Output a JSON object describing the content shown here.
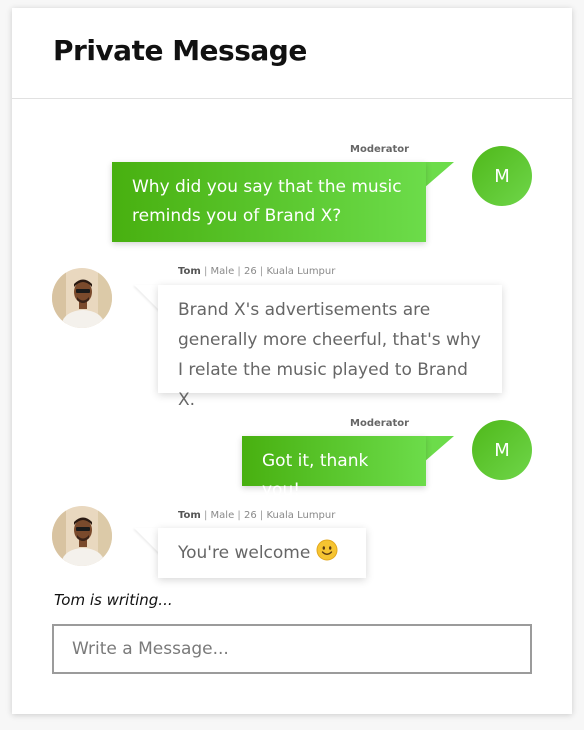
{
  "header": {
    "title": "Private Message"
  },
  "messages": [
    {
      "sender": "Moderator",
      "avatar_initial": "M",
      "lines": [
        "Why did you say that the music",
        "reminds you of Brand X?"
      ]
    },
    {
      "name": "Tom",
      "gender": "Male",
      "age": "26",
      "location": "Kuala Lumpur",
      "sep": "|",
      "lines": [
        "Brand X's advertisements are",
        "generally more cheerful, that's why",
        "I relate the music played to Brand X."
      ]
    },
    {
      "sender": "Moderator",
      "avatar_initial": "M",
      "text": "Got it, thank you!"
    },
    {
      "name": "Tom",
      "gender": "Male",
      "age": "26",
      "location": "Kuala Lumpur",
      "sep": "|",
      "text": "You're welcome",
      "emoji": "smiling-face-icon"
    }
  ],
  "typing_status": "Tom is writing...",
  "composer": {
    "placeholder": "Write a Message..."
  },
  "colors": {
    "moderator_gradient_start": "#48b010",
    "moderator_gradient_end": "#6cdc4a",
    "user_bubble": "#ffffff",
    "user_text": "#666666"
  }
}
